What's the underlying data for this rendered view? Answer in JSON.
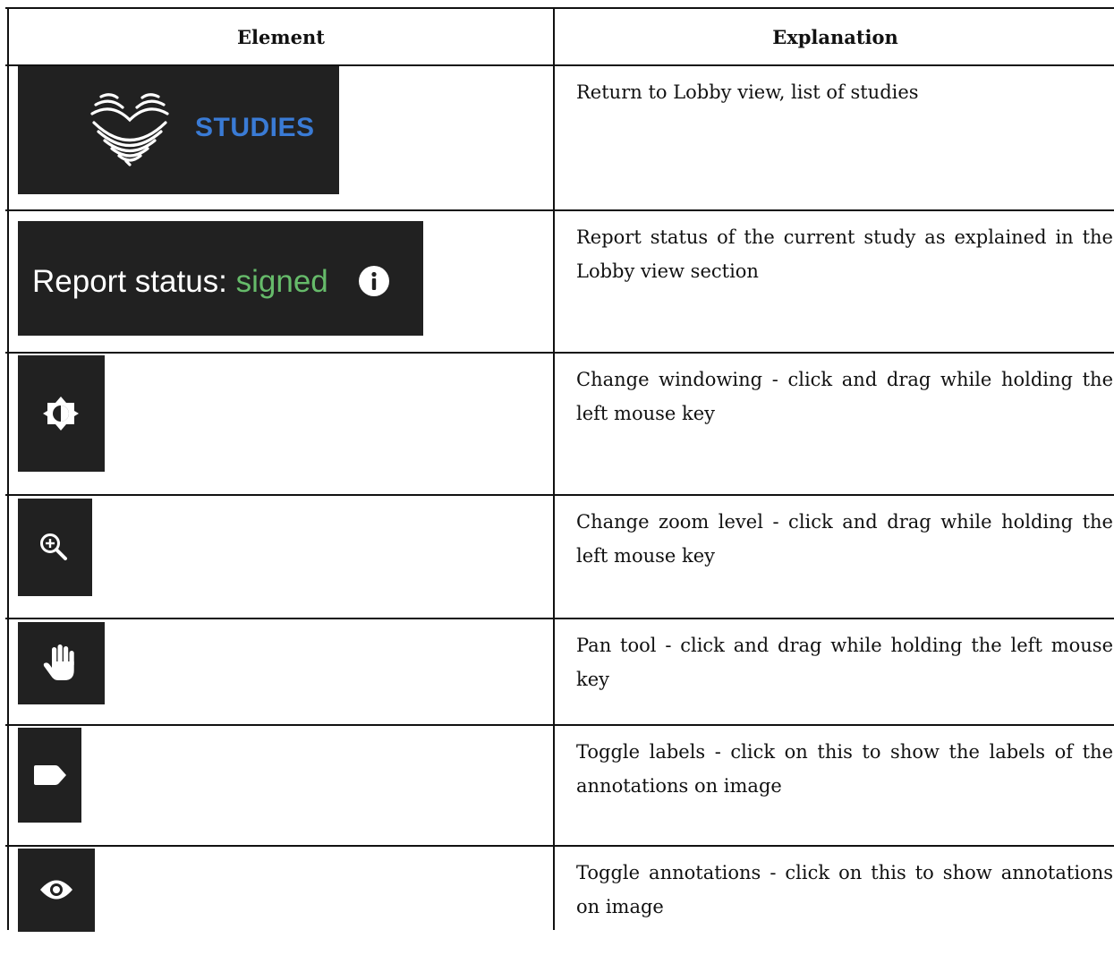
{
  "table": {
    "header": {
      "element": "Element",
      "explanation": "Explanation"
    },
    "rows": [
      {
        "element_kind": "studies-button",
        "label": "STUDIES",
        "label_color": "#3a7bd5",
        "icon": "heart-waves-logo-icon",
        "explanation": "Return to Lobby view, list of studies"
      },
      {
        "element_kind": "report-status",
        "label": "Report status:",
        "value": "signed",
        "value_color": "#66bb6a",
        "icon": "info-icon",
        "explanation": "Report status of the current study as explained in the Lobby view section"
      },
      {
        "element_kind": "tool-button",
        "icon": "brightness-icon",
        "explanation": "Change windowing - click and drag while holding the left mouse key"
      },
      {
        "element_kind": "tool-button",
        "icon": "zoom-in-icon",
        "explanation": "Change zoom level - click and drag while holding the left mouse key"
      },
      {
        "element_kind": "tool-button",
        "icon": "pan-hand-icon",
        "explanation": "Pan tool - click and drag while holding the left mouse key"
      },
      {
        "element_kind": "tool-button",
        "icon": "label-tag-icon",
        "explanation": "Toggle labels - click on this to show the labels of the annotations on image"
      },
      {
        "element_kind": "tool-button",
        "icon": "eye-icon",
        "explanation": "Toggle annotations - click on this to show annotations on image"
      }
    ]
  },
  "colors": {
    "icon_background": "#212121",
    "icon_foreground": "#ffffff",
    "rule": "#111111"
  }
}
